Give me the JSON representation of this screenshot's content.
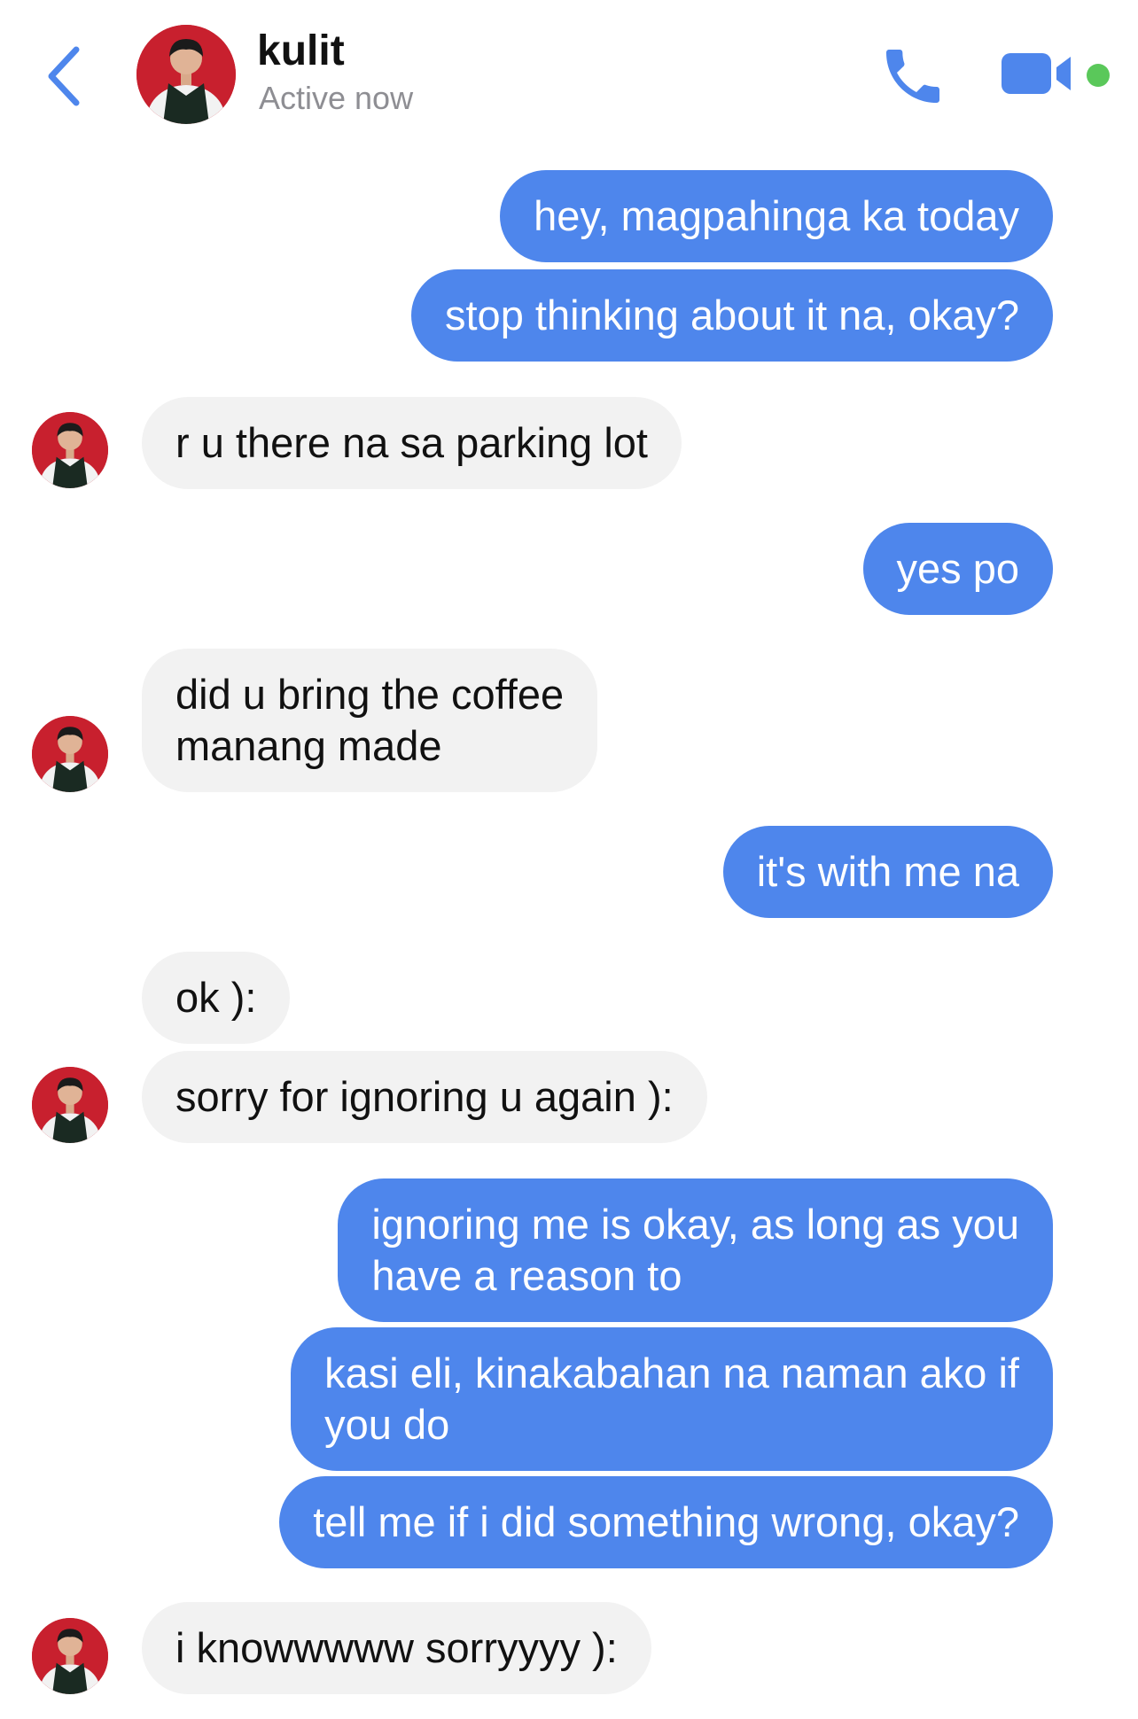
{
  "header": {
    "contact_name": "kulit",
    "status": "Active now",
    "icons": {
      "back": "chevron-left-icon",
      "call": "phone-icon",
      "video": "video-camera-icon"
    }
  },
  "colors": {
    "accent": "#4e86ec",
    "incoming_bubble": "#f2f2f2",
    "active_dot": "#5ac85a",
    "avatar_bg": "#c8202e"
  },
  "messages": [
    {
      "from": "me",
      "text": "hey, magpahinga ka today"
    },
    {
      "from": "me",
      "text": "stop thinking about it na, okay?"
    },
    {
      "from": "them",
      "text": "r u there na sa parking lot"
    },
    {
      "from": "me",
      "text": "yes po"
    },
    {
      "from": "them",
      "text": "did u bring the coffee\nmanang made"
    },
    {
      "from": "me",
      "text": "it's with me na"
    },
    {
      "from": "them",
      "text": "ok ):"
    },
    {
      "from": "them",
      "text": "sorry for ignoring u again ):"
    },
    {
      "from": "me",
      "text": "ignoring me is okay, as long as you\nhave a reason to"
    },
    {
      "from": "me",
      "text": "kasi eli, kinakabahan na naman ako if\nyou do"
    },
    {
      "from": "me",
      "text": "tell me if i did something wrong, okay?"
    },
    {
      "from": "them",
      "text": "i knowwwww sorryyyy ):"
    }
  ]
}
